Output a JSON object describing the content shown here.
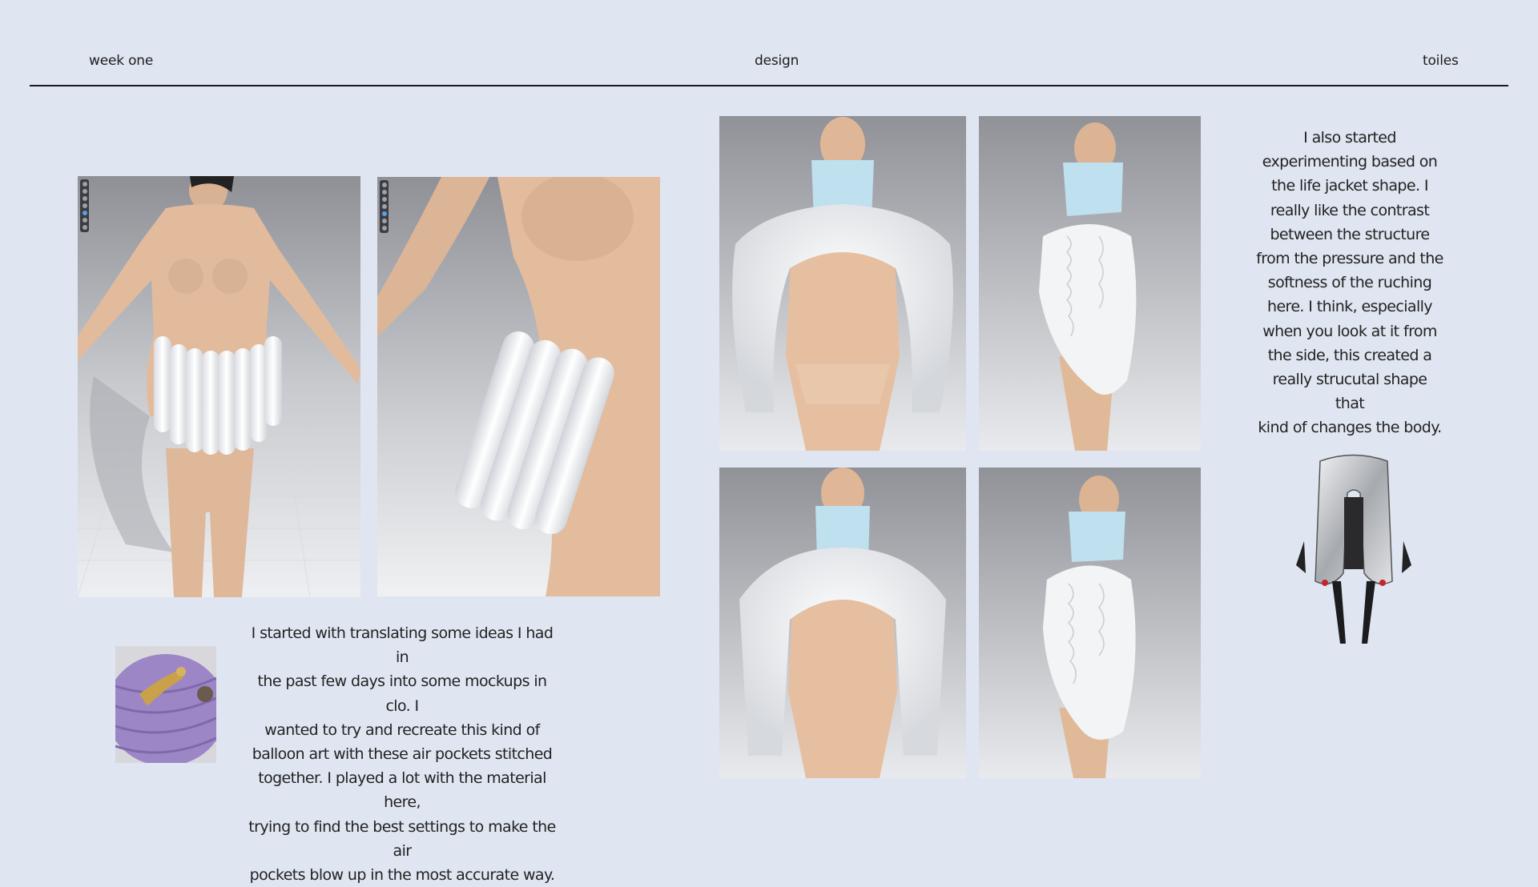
{
  "header": {
    "left": "week one",
    "center": "design",
    "right": "toiles"
  },
  "panels": {
    "front_skirt": "avatar-front-inflatable-skirt",
    "side_skirt": "avatar-side-inflatable-skirt",
    "front_jacket_1": "avatar-front-ruched-jacket-1",
    "side_jacket_1": "avatar-side-ruched-jacket-1",
    "front_jacket_2": "avatar-front-ruched-jacket-2",
    "side_jacket_2": "avatar-side-ruched-jacket-2",
    "balloon_ref": "purple-balloon-art-reference",
    "life_jacket_ref": "silver-life-jacket-reference"
  },
  "text": {
    "left_paragraph": "I started with translating some ideas I had in\nthe past few days into some mockups in clo. I\nwanted to try and recreate this kind of\nballoon art with these air pockets stitched\ntogether. I played a lot with the material here,\ntrying to find the best settings to make the air\npockets blow up in the most accurate way.",
    "right_paragraph": "I also started\nexperimenting based on\nthe life jacket shape. I\nreally like the contrast\nbetween the structure\nfrom the pressure and the\nsoftness of the ruching\nhere. I think, especially\nwhen you look at it from\nthe side, this created a\nreally strucutal shape that\nkind of changes the body."
  },
  "colors": {
    "background": "#dfe5f1",
    "skin": "#e6c2a4",
    "garment_white": "#f4f5f7",
    "collar_blue": "#bfe0ee",
    "balloon_purple": "#9c86c6",
    "life_jacket_silver": "#c9ccd1"
  }
}
